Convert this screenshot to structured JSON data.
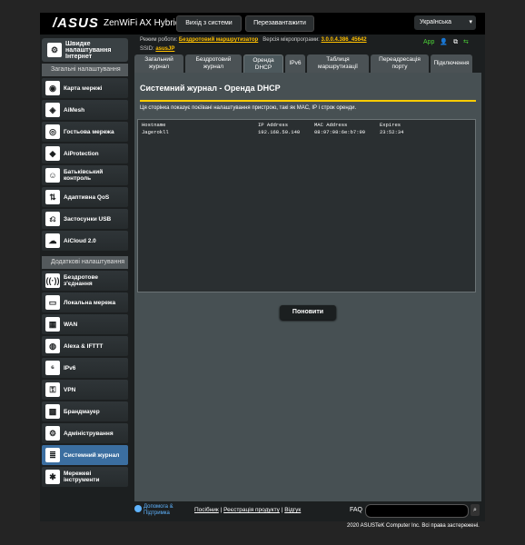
{
  "header": {
    "logo": "/ASUS",
    "model": "ZenWiFi AX Hybrid",
    "logout_label": "Вихід з системи",
    "reboot_label": "Перезавантажити",
    "language": "Українська"
  },
  "info": {
    "mode_label": "Режим роботи:",
    "mode_value": "Бездротовий маршрутизатор",
    "firmware_label": "Версія мікропрограми:",
    "firmware_value": "3.0.0.4.386_45642",
    "ssid_label": "SSID:",
    "ssid_value": "asusJP",
    "app_label": "App"
  },
  "sidebar": {
    "quick_setup": "Швидке налаштування Інтернет",
    "general_header": "Загальні налаштування",
    "general_items": [
      {
        "label": "Карта мережі",
        "icon": "network-map-icon"
      },
      {
        "label": "AiMesh",
        "icon": "aimesh-icon"
      },
      {
        "label": "Гостьова мережа",
        "icon": "guest-network-icon"
      },
      {
        "label": "AiProtection",
        "icon": "aiprotection-icon"
      },
      {
        "label": "Батьківський контроль",
        "icon": "parental-control-icon"
      },
      {
        "label": "Адаптивна QoS",
        "icon": "qos-icon"
      },
      {
        "label": "Застосунки USB",
        "icon": "usb-icon"
      },
      {
        "label": "AiCloud 2.0",
        "icon": "aicloud-icon"
      }
    ],
    "advanced_header": "Додаткові налаштування",
    "advanced_items": [
      {
        "label": "Бездротове з'єднання",
        "icon": "wireless-icon"
      },
      {
        "label": "Локальна мережа",
        "icon": "lan-icon"
      },
      {
        "label": "WAN",
        "icon": "wan-icon"
      },
      {
        "label": "Alexa & IFTTT",
        "icon": "alexa-icon"
      },
      {
        "label": "IPv6",
        "icon": "ipv6-icon"
      },
      {
        "label": "VPN",
        "icon": "vpn-icon"
      },
      {
        "label": "Брандмауер",
        "icon": "firewall-icon"
      },
      {
        "label": "Адміністрування",
        "icon": "administration-icon"
      },
      {
        "label": "Системний журнал",
        "icon": "system-log-icon"
      },
      {
        "label": "Мережеві інструменти",
        "icon": "network-tools-icon"
      }
    ]
  },
  "tabs": [
    {
      "label": "Загальний журнал"
    },
    {
      "label": "Бездротовий журнал"
    },
    {
      "label": "Оренда DHCP"
    },
    {
      "label": "IPv6"
    },
    {
      "label": "Таблиця маршрутизації"
    },
    {
      "label": "Переадресація порту"
    },
    {
      "label": "Підключення"
    }
  ],
  "panel": {
    "title": "Системний журнал - Оренда DHCP",
    "description": "Ця сторінка показує поєївані налаштування пристрою, такі як MAC, IP і строк оренди.",
    "columns": [
      "Hostname",
      "IP Address",
      "MAC Address",
      "Expires"
    ],
    "rows": [
      [
        "Jagerokll",
        "192.168.50.140",
        "08:97:98:6e:b7:99",
        "23:52:34"
      ]
    ],
    "refresh_label": "Поновити"
  },
  "footer": {
    "help_line1": "Допомога &",
    "help_line2": "Підтримка",
    "link_manual": "Посібник",
    "link_registration": "Реєстрація продукту",
    "link_feedback": "Відгук",
    "faq_label": "FAQ",
    "copyright": "2020 ASUSTeK Computer Inc. Всі права застережені."
  }
}
